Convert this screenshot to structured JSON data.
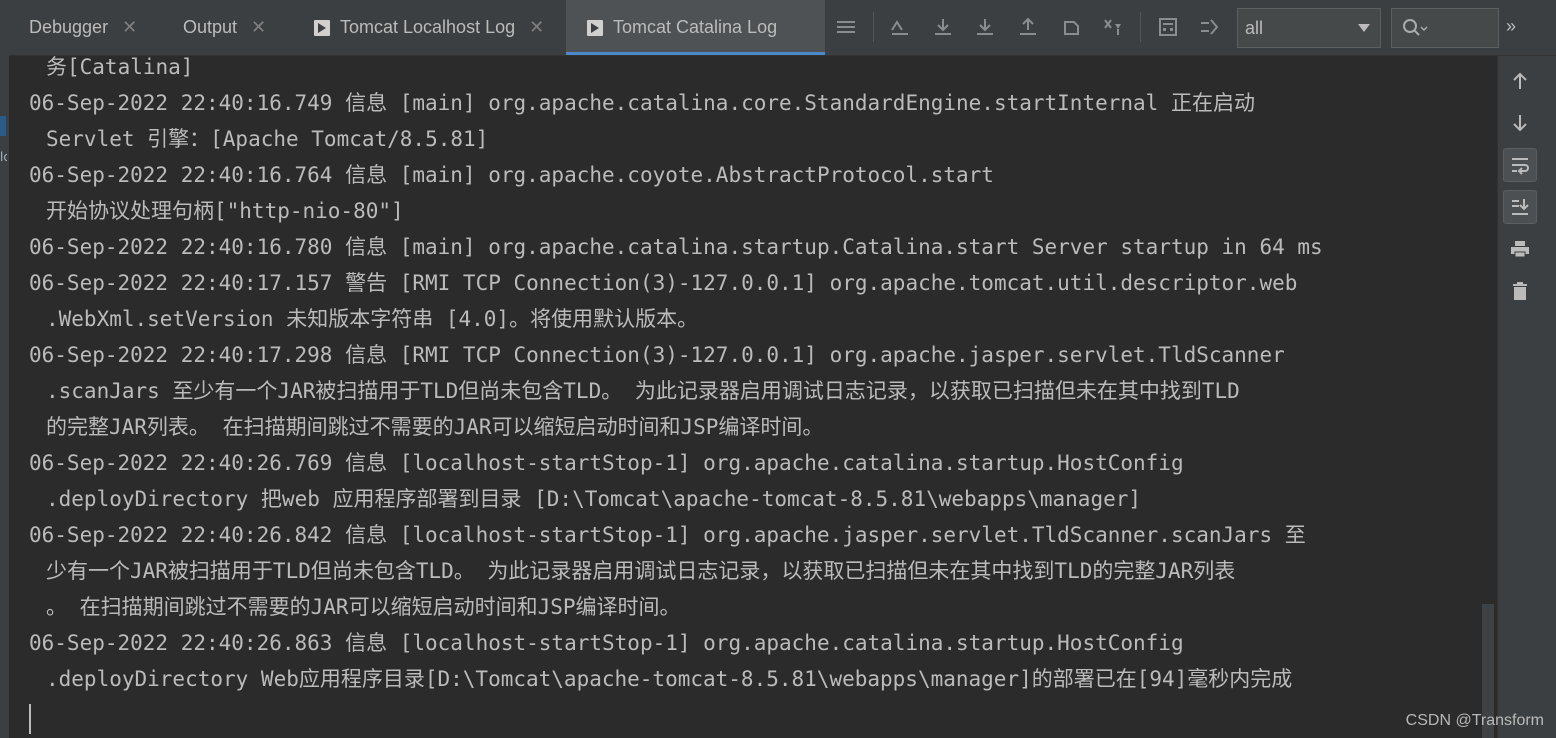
{
  "tabs": [
    {
      "label": "Debugger",
      "active": false,
      "icon": null
    },
    {
      "label": "Output",
      "active": false,
      "icon": null
    },
    {
      "label": "Tomcat Localhost Log",
      "active": false,
      "icon": "console-icon"
    },
    {
      "label": "Tomcat Catalina Log",
      "active": true,
      "icon": "console-icon"
    }
  ],
  "toolbar": {
    "filter_value": "all",
    "tools": [
      "menu-icon",
      "soft-wrap-icon",
      "download-icon",
      "download-all-icon",
      "upload-icon",
      "restore-icon",
      "clear-filter-icon",
      "calculator-icon",
      "compare-icon"
    ],
    "more_label": "»"
  },
  "log": {
    "lines": [
      {
        "text": "务[Catalina]",
        "cont": true
      },
      {
        "text": "06-Sep-2022 22:40:16.749 信息 [main] org.apache.catalina.core.StandardEngine.startInternal 正在启动",
        "cont": false
      },
      {
        "text": "Servlet 引擎：[Apache Tomcat/8.5.81]",
        "cont": true
      },
      {
        "text": "06-Sep-2022 22:40:16.764 信息 [main] org.apache.coyote.AbstractProtocol.start",
        "cont": false
      },
      {
        "text": "开始协议处理句柄[\"http-nio-80\"]",
        "cont": true
      },
      {
        "text": "06-Sep-2022 22:40:16.780 信息 [main] org.apache.catalina.startup.Catalina.start Server startup in 64 ms",
        "cont": false
      },
      {
        "text": "06-Sep-2022 22:40:17.157 警告 [RMI TCP Connection(3)-127.0.0.1] org.apache.tomcat.util.descriptor.web",
        "cont": false
      },
      {
        "text": ".WebXml.setVersion 未知版本字符串 [4.0]。将使用默认版本。",
        "cont": true
      },
      {
        "text": "06-Sep-2022 22:40:17.298 信息 [RMI TCP Connection(3)-127.0.0.1] org.apache.jasper.servlet.TldScanner",
        "cont": false
      },
      {
        "text": ".scanJars 至少有一个JAR被扫描用于TLD但尚未包含TLD。 为此记录器启用调试日志记录，以获取已扫描但未在其中找到TLD",
        "cont": true
      },
      {
        "text": "的完整JAR列表。 在扫描期间跳过不需要的JAR可以缩短启动时间和JSP编译时间。",
        "cont": true
      },
      {
        "text": "06-Sep-2022 22:40:26.769 信息 [localhost-startStop-1] org.apache.catalina.startup.HostConfig",
        "cont": false
      },
      {
        "text": ".deployDirectory 把web 应用程序部署到目录 [D:\\Tomcat\\apache-tomcat-8.5.81\\webapps\\manager]",
        "cont": true
      },
      {
        "text": "06-Sep-2022 22:40:26.842 信息 [localhost-startStop-1] org.apache.jasper.servlet.TldScanner.scanJars 至",
        "cont": false
      },
      {
        "text": "少有一个JAR被扫描用于TLD但尚未包含TLD。 为此记录器启用调试日志记录，以获取已扫描但未在其中找到TLD的完整JAR列表",
        "cont": true
      },
      {
        "text": "。 在扫描期间跳过不需要的JAR可以缩短启动时间和JSP编译时间。",
        "cont": true
      },
      {
        "text": "06-Sep-2022 22:40:26.863 信息 [localhost-startStop-1] org.apache.catalina.startup.HostConfig",
        "cont": false
      },
      {
        "text": ".deployDirectory Web应用程序目录[D:\\Tomcat\\apache-tomcat-8.5.81\\webapps\\manager]的部署已在[94]毫秒内完成",
        "cont": true
      }
    ]
  },
  "side_tools": [
    "arrow-up-icon",
    "arrow-down-icon",
    "soft-wrap-icon",
    "scroll-to-end-icon",
    "print-icon",
    "trash-icon"
  ],
  "watermark": "CSDN @Transform",
  "colors": {
    "background": "#2b2b2b",
    "panel": "#3c3f41",
    "text": "#bbbbbb",
    "active_tab_underline": "#4a88c7"
  }
}
